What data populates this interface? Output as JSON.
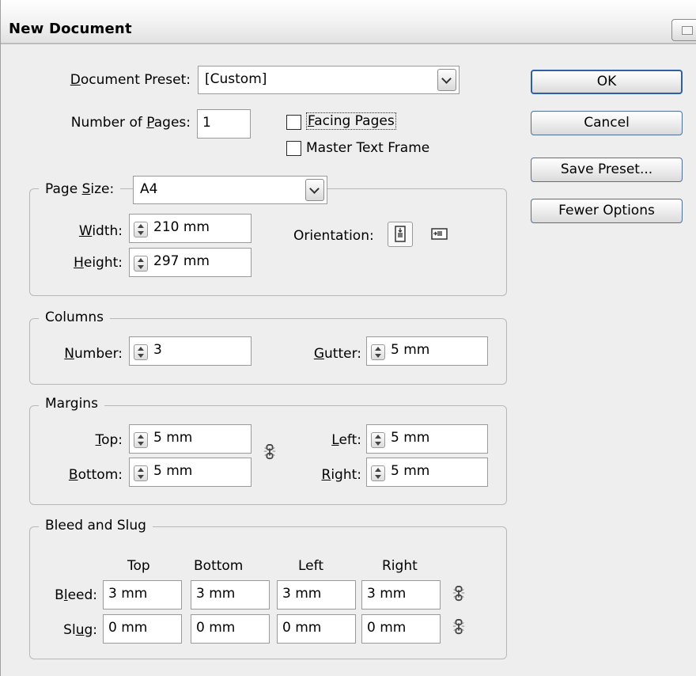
{
  "window": {
    "title": "New Document"
  },
  "preset": {
    "label": "Document Preset:",
    "value": "[Custom]"
  },
  "pages": {
    "label": "Number of Pages:",
    "value": "1",
    "facing_pages": {
      "label": "Facing Pages",
      "checked": false
    },
    "master_text_frame": {
      "label": "Master Text Frame",
      "checked": false
    }
  },
  "buttons": {
    "ok": "OK",
    "cancel": "Cancel",
    "save_preset": "Save Preset...",
    "fewer_options": "Fewer Options"
  },
  "page_size": {
    "label": "Page Size:",
    "value": "A4",
    "width_label": "Width:",
    "width": "210 mm",
    "height_label": "Height:",
    "height": "297 mm",
    "orientation_label": "Orientation:",
    "orientation_selected": "portrait",
    "orientation_icons": [
      "portrait-orientation-icon",
      "landscape-orientation-icon"
    ]
  },
  "columns": {
    "legend": "Columns",
    "number_label": "Number:",
    "number": "3",
    "gutter_label": "Gutter:",
    "gutter": "5 mm"
  },
  "margins": {
    "legend": "Margins",
    "top_label": "Top:",
    "top": "5 mm",
    "bottom_label": "Bottom:",
    "bottom": "5 mm",
    "left_label": "Left:",
    "left": "5 mm",
    "right_label": "Right:",
    "right": "5 mm",
    "link_icon": "chain-link-icon"
  },
  "bleed_slug": {
    "legend": "Bleed and Slug",
    "columns": [
      "Top",
      "Bottom",
      "Left",
      "Right"
    ],
    "bleed_label": "Bleed:",
    "bleed": [
      "3 mm",
      "3 mm",
      "3 mm",
      "3 mm"
    ],
    "slug_label": "Slug:",
    "slug": [
      "0 mm",
      "0 mm",
      "0 mm",
      "0 mm"
    ]
  },
  "colors": {
    "dialog_bg": "#eeeeee",
    "ok_border": "#2f5fa8"
  }
}
